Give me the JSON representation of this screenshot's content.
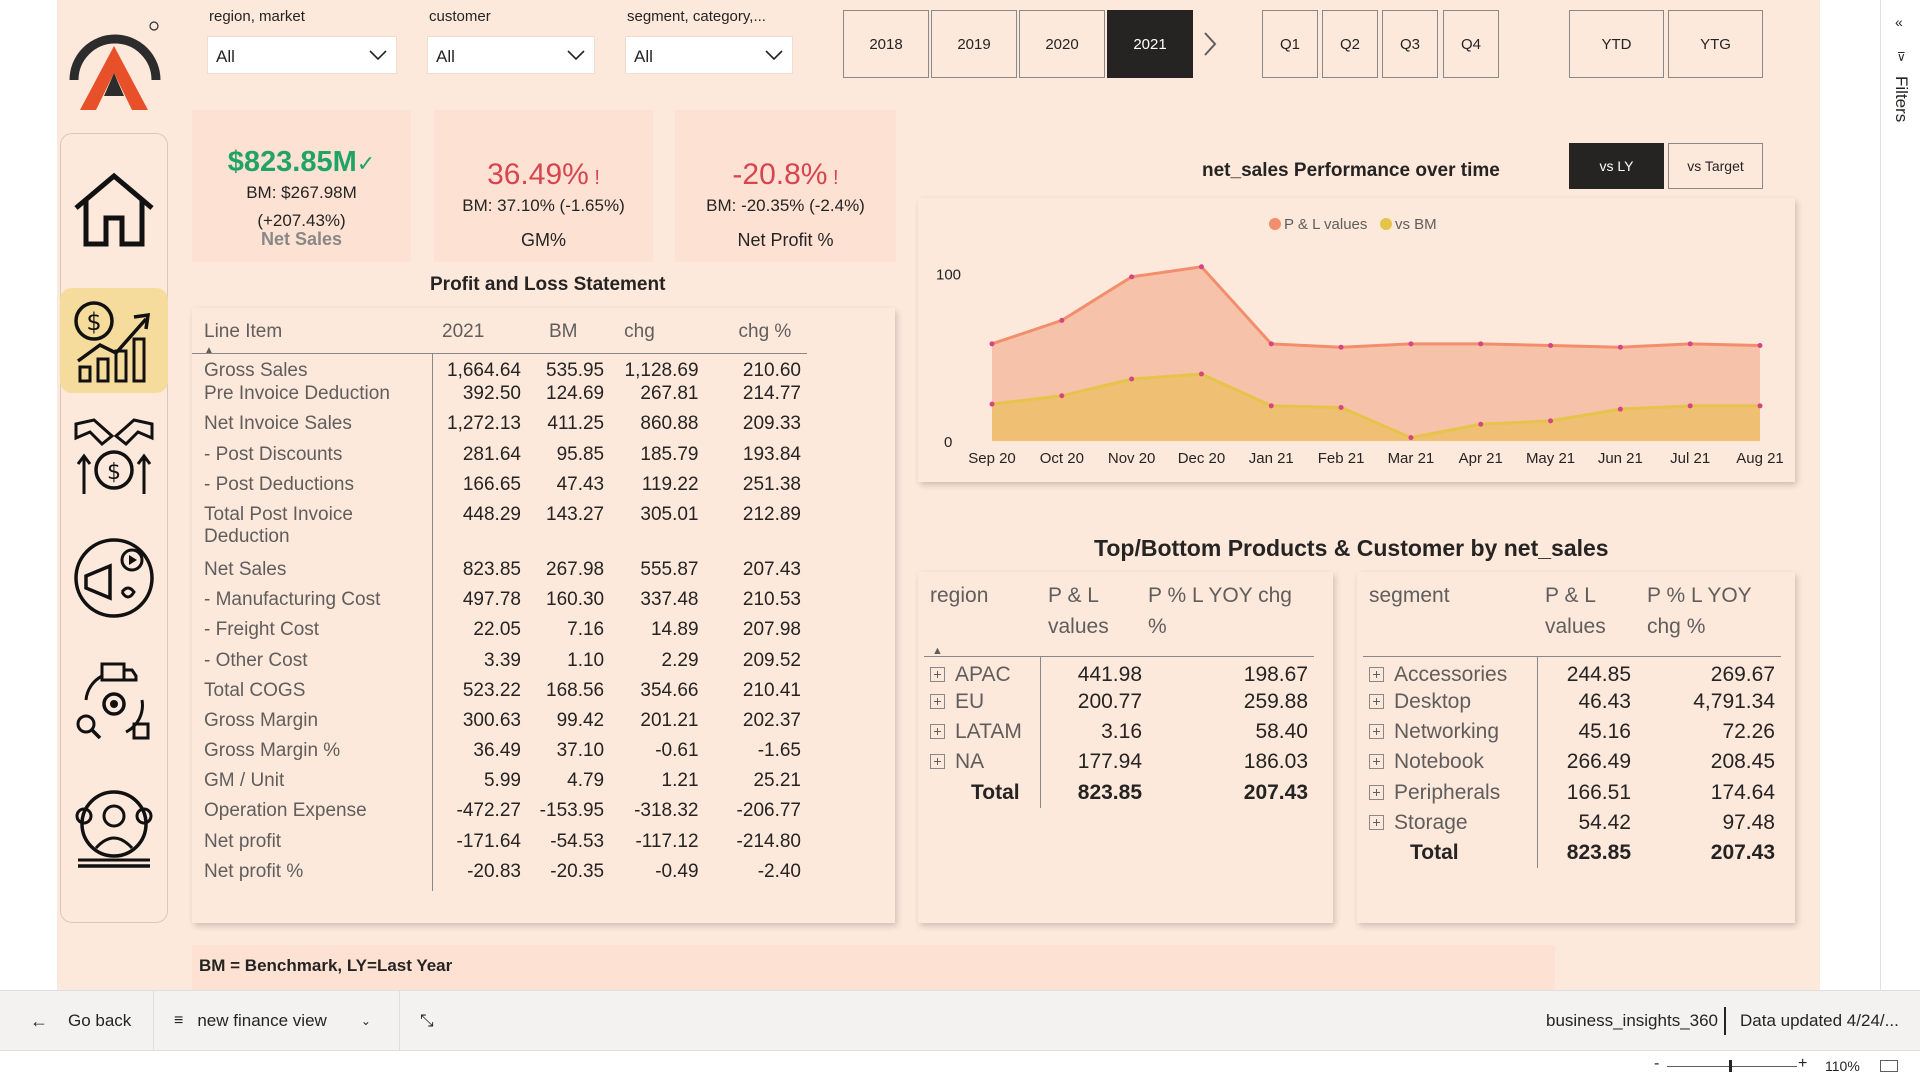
{
  "filters": [
    {
      "label": "region, market",
      "value": "All"
    },
    {
      "label": "customer",
      "value": "All"
    },
    {
      "label": "segment, category,...",
      "value": "All"
    }
  ],
  "years": [
    "2018",
    "2019",
    "2020",
    "2021"
  ],
  "selected_year": "2021",
  "quarters": [
    "Q1",
    "Q2",
    "Q3",
    "Q4"
  ],
  "periods": [
    "YTD",
    "YTG"
  ],
  "compare_toggle": [
    "vs LY",
    "vs Target"
  ],
  "kpis": {
    "net_sales": {
      "value": "$823.85M",
      "bm": "BM: $267.98M",
      "chg": "(+207.43%)",
      "caption": "Net Sales"
    },
    "gm": {
      "value": "36.49%",
      "bm": "BM: 37.10% (-1.65%)",
      "caption": "GM%"
    },
    "np": {
      "value": "-20.8%",
      "bm": "BM: -20.35% (-2.4%)",
      "caption": "Net Profit %"
    }
  },
  "colors": {
    "good": "#21a366",
    "bad": "#d64550",
    "pl_series": "#f28e6b",
    "bm_series": "#e6c34a"
  },
  "pl": {
    "title": "Profit and Loss Statement",
    "headers": [
      "Line Item",
      "2021",
      "BM",
      "chg",
      "chg %"
    ],
    "rows": [
      [
        "Gross Sales",
        "1,664.64",
        "535.95",
        "1,128.69",
        "210.60"
      ],
      [
        "Pre Invoice Deduction",
        "392.50",
        "124.69",
        "267.81",
        "214.77"
      ],
      [
        "Net Invoice Sales",
        "1,272.13",
        "411.25",
        "860.88",
        "209.33"
      ],
      [
        "- Post Discounts",
        "281.64",
        "95.85",
        "185.79",
        "193.84"
      ],
      [
        "- Post Deductions",
        "166.65",
        "47.43",
        "119.22",
        "251.38"
      ],
      [
        "Total Post Invoice Deduction",
        "448.29",
        "143.27",
        "305.01",
        "212.89"
      ],
      [
        "Net Sales",
        "823.85",
        "267.98",
        "555.87",
        "207.43"
      ],
      [
        "- Manufacturing Cost",
        "497.78",
        "160.30",
        "337.48",
        "210.53"
      ],
      [
        "- Freight Cost",
        "22.05",
        "7.16",
        "14.89",
        "207.98"
      ],
      [
        "- Other Cost",
        "3.39",
        "1.10",
        "2.29",
        "209.52"
      ],
      [
        "Total COGS",
        "523.22",
        "168.56",
        "354.66",
        "210.41"
      ],
      [
        "Gross Margin",
        "300.63",
        "99.42",
        "201.21",
        "202.37"
      ],
      [
        "Gross Margin %",
        "36.49",
        "37.10",
        "-0.61",
        "-1.65"
      ],
      [
        "GM / Unit",
        "5.99",
        "4.79",
        "1.21",
        "25.21"
      ],
      [
        "Operation Expense",
        "-472.27",
        "-153.95",
        "-318.32",
        "-206.77"
      ],
      [
        "Net profit",
        "-171.64",
        "-54.53",
        "-117.12",
        "-214.80"
      ],
      [
        "Net profit %",
        "-20.83",
        "-20.35",
        "-0.49",
        "-2.40"
      ]
    ]
  },
  "chart_title": "net_sales Performance over time",
  "chart_data": {
    "type": "area",
    "title": "net_sales Performance over time",
    "categories": [
      "Sep 20",
      "Oct 20",
      "Nov 20",
      "Dec 20",
      "Jan 21",
      "Feb 21",
      "Mar 21",
      "Apr 21",
      "May 21",
      "Jun 21",
      "Jul 21",
      "Aug 21"
    ],
    "series": [
      {
        "name": "P & L values",
        "values": [
          58,
          72,
          98,
          104,
          58,
          56,
          58,
          58,
          57,
          56,
          58,
          57
        ]
      },
      {
        "name": "vs BM",
        "values": [
          22,
          27,
          37,
          40,
          21,
          20,
          2,
          10,
          12,
          19,
          21,
          21
        ]
      }
    ],
    "yticks": [
      "0",
      "100"
    ],
    "ylim": [
      0,
      120
    ],
    "legend": "top"
  },
  "topbottom_title": "Top/Bottom Products & Customer by net_sales",
  "region_table": {
    "headers": [
      "region",
      "P & L values",
      "P % L YOY chg %"
    ],
    "rows": [
      [
        "APAC",
        "441.98",
        "198.67"
      ],
      [
        "EU",
        "200.77",
        "259.88"
      ],
      [
        "LATAM",
        "3.16",
        "58.40"
      ],
      [
        "NA",
        "177.94",
        "186.03"
      ]
    ],
    "total": [
      "Total",
      "823.85",
      "207.43"
    ]
  },
  "segment_table": {
    "headers": [
      "segment",
      "P & L values",
      "P % L YOY chg %"
    ],
    "rows": [
      [
        "Accessories",
        "244.85",
        "269.67"
      ],
      [
        "Desktop",
        "46.43",
        "4,791.34"
      ],
      [
        "Networking",
        "45.16",
        "72.26"
      ],
      [
        "Notebook",
        "266.49",
        "208.45"
      ],
      [
        "Peripherals",
        "166.51",
        "174.64"
      ],
      [
        "Storage",
        "54.42",
        "97.48"
      ]
    ],
    "total": [
      "Total",
      "823.85",
      "207.43"
    ]
  },
  "footnote": "BM = Benchmark, LY=Last Year",
  "bottom": {
    "back": "Go back",
    "page": "new finance view",
    "workspace": "business_insights_360",
    "updated": "Data updated 4/24/..."
  },
  "status": {
    "zoom": "110%"
  },
  "filters_pane": "Filters"
}
